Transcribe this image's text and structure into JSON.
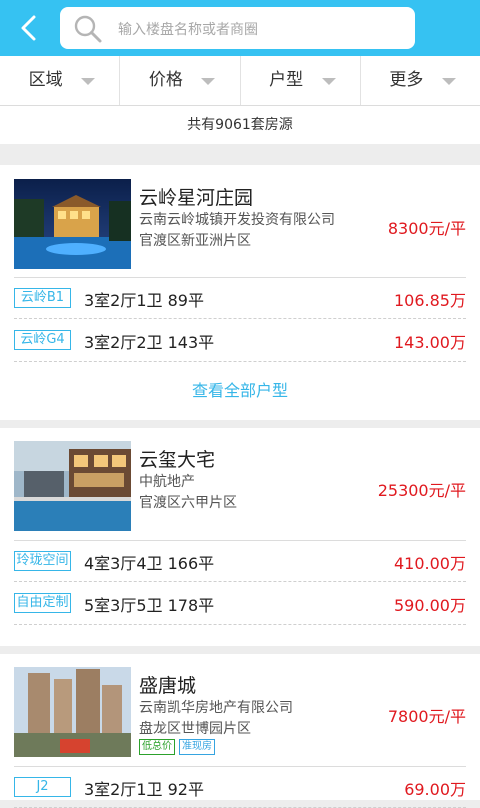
{
  "search": {
    "placeholder": "输入楼盘名称或者商圈"
  },
  "filters": [
    "区域",
    "价格",
    "户型",
    "更多"
  ],
  "count_text": "共有9061套房源",
  "projects": [
    {
      "name": "云岭星河庄园",
      "developer": "云南云岭城镇开发投资有限公司",
      "area": "官渡区新亚洲片区",
      "price": "8300元/平",
      "units": [
        {
          "badge": "云岭B1",
          "spec": "3室2厅1卫 89平",
          "price": "106.85万"
        },
        {
          "badge": "云岭G4",
          "spec": "3室2厅2卫 143平",
          "price": "143.00万"
        }
      ],
      "view_all": "查看全部户型"
    },
    {
      "name": "云玺大宅",
      "developer": "中航地产",
      "area": "官渡区六甲片区",
      "price": "25300元/平",
      "units": [
        {
          "badge": "玲珑空间",
          "spec": "4室3厅4卫 166平",
          "price": "410.00万"
        },
        {
          "badge": "自由定制",
          "spec": "5室3厅5卫 178平",
          "price": "590.00万"
        }
      ]
    },
    {
      "name": "盛唐城",
      "developer": "云南凯华房地产有限公司",
      "area": "盘龙区世博园片区",
      "price": "7800元/平",
      "tags": [
        "低总价",
        "准现房"
      ],
      "units": [
        {
          "badge": "J2",
          "spec": "3室2厅1卫 92平",
          "price": "69.00万"
        }
      ]
    }
  ],
  "colors": {
    "header": "#36c2f2",
    "accent": "#36b6e8",
    "price": "#e0191f"
  }
}
